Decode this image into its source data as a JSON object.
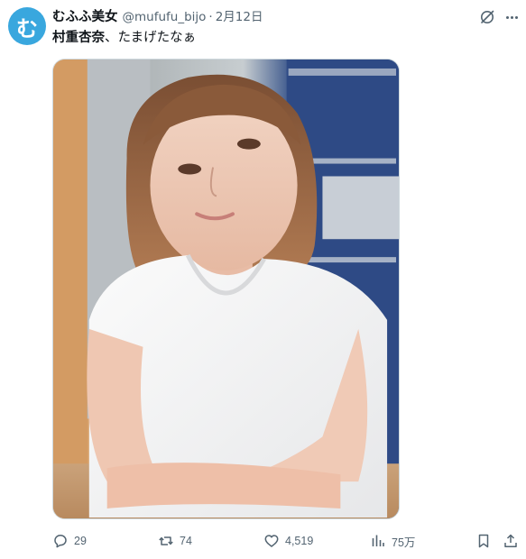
{
  "post": {
    "avatar_glyph": "む",
    "display_name": "むふふ美女",
    "handle": "@mufufu_bijo",
    "separator": "·",
    "date": "2月12日",
    "text_bold": "村重杏奈",
    "text_rest": "、たまげたなぁ",
    "image_alt": "photo of a woman in a white t-shirt"
  },
  "header_icons": {
    "grok": "grok-icon",
    "more": "more-dots-icon"
  },
  "actions": {
    "replies": "29",
    "reposts": "74",
    "likes": "4,519",
    "views": "75万"
  },
  "colors": {
    "avatar": "#39a7de",
    "secondary_text": "#536471",
    "primary_text": "#0f1419"
  }
}
